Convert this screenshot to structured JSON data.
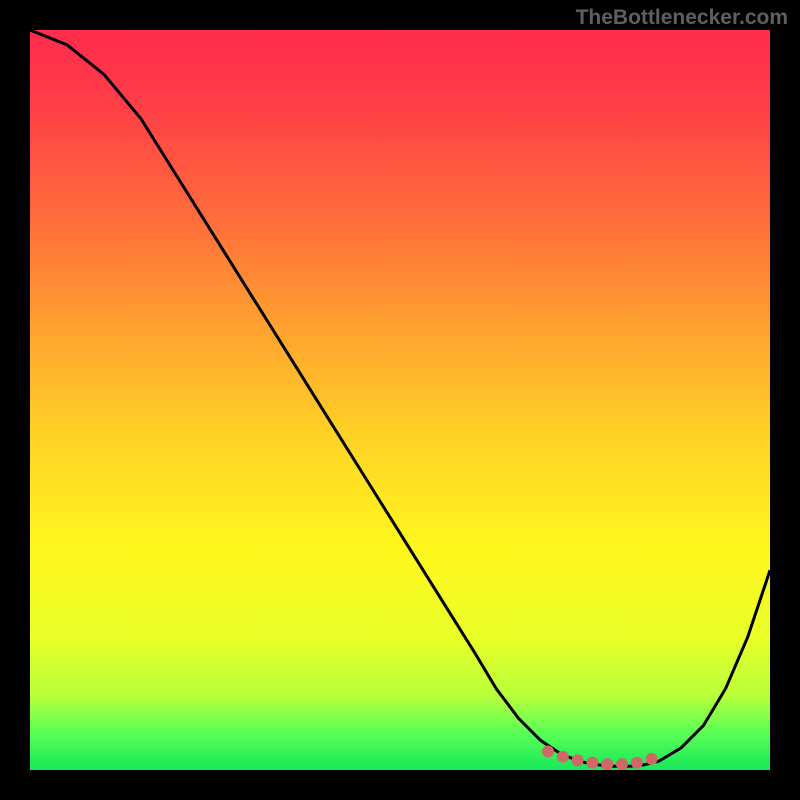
{
  "watermark": "TheBottlenecker.com",
  "chart_data": {
    "type": "line",
    "title": "",
    "xlabel": "",
    "ylabel": "",
    "xlim": [
      0,
      100
    ],
    "ylim": [
      0,
      100
    ],
    "background": {
      "type": "vertical-gradient",
      "stops": [
        {
          "offset": 0.0,
          "color": "#ff2b4c"
        },
        {
          "offset": 0.1,
          "color": "#ff3e47"
        },
        {
          "offset": 0.25,
          "color": "#ff6b3b"
        },
        {
          "offset": 0.4,
          "color": "#ffa130"
        },
        {
          "offset": 0.55,
          "color": "#ffd226"
        },
        {
          "offset": 0.7,
          "color": "#fff71e"
        },
        {
          "offset": 0.82,
          "color": "#eaff28"
        },
        {
          "offset": 0.9,
          "color": "#b7ff3a"
        },
        {
          "offset": 0.95,
          "color": "#59ff55"
        },
        {
          "offset": 1.0,
          "color": "#17e858"
        }
      ]
    },
    "series": [
      {
        "name": "bottleneck-curve",
        "color": "#000000",
        "x": [
          0,
          5,
          10,
          15,
          20,
          25,
          30,
          35,
          40,
          45,
          50,
          55,
          60,
          63,
          66,
          69,
          72,
          75,
          78,
          81,
          83,
          85,
          88,
          91,
          94,
          97,
          100
        ],
        "y": [
          100,
          98,
          94,
          88,
          80,
          72,
          64,
          56,
          48,
          40,
          32,
          24,
          16,
          11,
          7,
          4,
          2,
          1,
          0.5,
          0.5,
          0.7,
          1.2,
          3,
          6,
          11,
          18,
          27
        ]
      }
    ],
    "markers": {
      "name": "optimal-zone-dots",
      "color": "#d16868",
      "x": [
        70,
        72,
        74,
        76,
        78,
        80,
        82,
        84
      ],
      "y": [
        2.5,
        1.8,
        1.3,
        1.0,
        0.8,
        0.8,
        1.0,
        1.5
      ]
    }
  }
}
